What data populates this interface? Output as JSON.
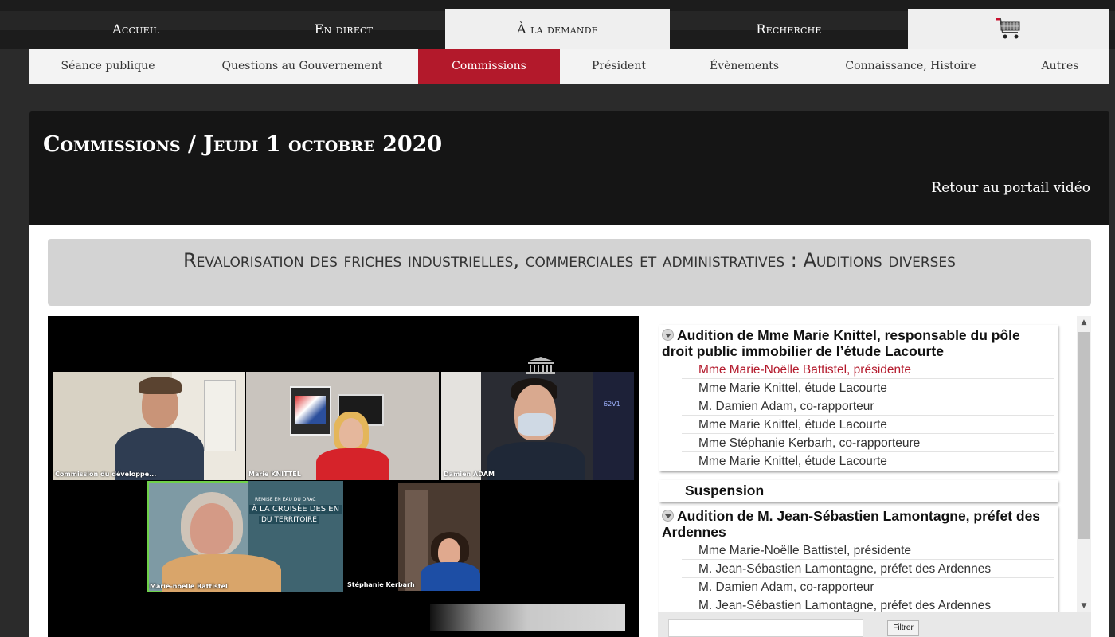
{
  "main_nav": [
    {
      "label": "Accueil",
      "active": false
    },
    {
      "label": "En direct",
      "active": false
    },
    {
      "label": "À la demande",
      "active": true
    },
    {
      "label": "Recherche",
      "active": false
    }
  ],
  "cart_icon": "shopping-cart-icon",
  "sub_nav": [
    {
      "label": "Séance publique",
      "active": false
    },
    {
      "label": "Questions au Gouvernement",
      "active": false
    },
    {
      "label": "Commissions",
      "active": true
    },
    {
      "label": "Président",
      "active": false
    },
    {
      "label": "Évènements",
      "active": false
    },
    {
      "label": "Connaissance, Histoire",
      "active": false
    },
    {
      "label": "Autres",
      "active": false
    }
  ],
  "header": {
    "title": "Commissions / Jeudi 1 octobre 2020",
    "back_link": "Retour au portail vidéo"
  },
  "session_title": "Revalorisation des friches industrielles, commerciales et administratives : Auditions diverses",
  "video": {
    "participants": [
      {
        "name": "Commission du développe...",
        "speaking": false
      },
      {
        "name": "Marie KNITTEL",
        "speaking": false
      },
      {
        "name": "Damien ADAM",
        "speaking": false
      },
      {
        "name": "Marie-noëlle Battistel",
        "speaking": true
      },
      {
        "name": "Stéphanie Kerbarh",
        "speaking": false
      }
    ],
    "banner_lines": [
      "REMISE EN EAU DU DRAC",
      "À LA CROISÉE DES EN",
      "DU TERRITOIRE"
    ],
    "screen_text": "62V1"
  },
  "agenda": {
    "groups": [
      {
        "title": "Audition de Mme Marie Knittel, responsable du pôle droit public immobilier de l’étude Lacourte",
        "speakers": [
          {
            "label": "Mme Marie-Noëlle Battistel, présidente",
            "current": true
          },
          {
            "label": "Mme Marie Knittel, étude Lacourte",
            "current": false
          },
          {
            "label": "M. Damien Adam, co-rapporteur",
            "current": false
          },
          {
            "label": "Mme Marie Knittel, étude Lacourte",
            "current": false
          },
          {
            "label": "Mme Stéphanie Kerbarh, co-rapporteure",
            "current": false
          },
          {
            "label": "Mme Marie Knittel, étude Lacourte",
            "current": false
          }
        ]
      },
      {
        "title": "Audition de M. Jean-Sébastien Lamontagne, préfet des Ardennes",
        "speakers": [
          {
            "label": "Mme Marie-Noëlle Battistel, présidente",
            "current": false
          },
          {
            "label": "M. Jean-Sébastien Lamontagne, préfet des Ardennes",
            "current": false
          },
          {
            "label": "M. Damien Adam, co-rapporteur",
            "current": false
          },
          {
            "label": "M. Jean-Sébastien Lamontagne, préfet des Ardennes",
            "current": false
          }
        ]
      }
    ],
    "suspension": "Suspension"
  },
  "filter": {
    "placeholder": "",
    "button": "Filtrer"
  },
  "colors": {
    "accent": "#b3192b",
    "speaking_border": "#6fd14a"
  }
}
